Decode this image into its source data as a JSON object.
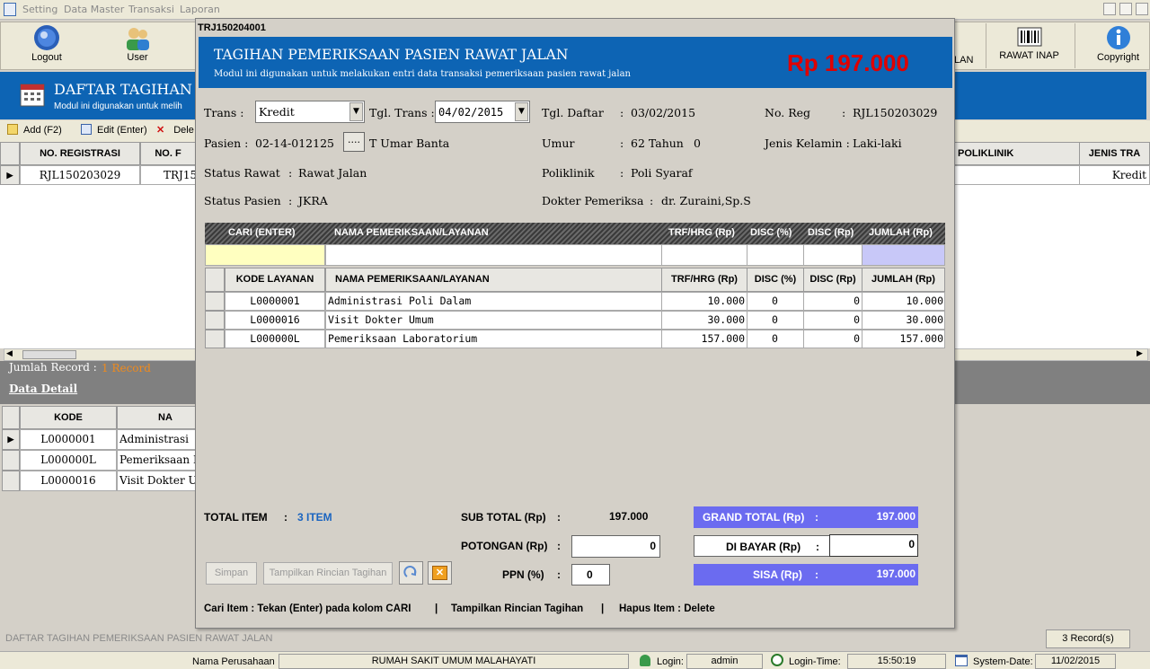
{
  "menubar": {
    "items": [
      "Setting",
      "Data Master",
      "Transaksi",
      "Laporan"
    ]
  },
  "toolbar": {
    "logout": "Logout",
    "user": "User",
    "lan_partial": "LAN",
    "rawat_inap": "RAWAT INAP",
    "copyright": "Copyright"
  },
  "main": {
    "title": "DAFTAR TAGIHAN",
    "subtitle": "Modul ini digunakan untuk melih",
    "actions": {
      "add": "Add (F2)",
      "edit": "Edit (Enter)",
      "delete": "Dele"
    },
    "columns": {
      "no_registrasi": "NO. REGISTRASI",
      "no_f": "NO. F",
      "poliklinik": "POLIKLINIK",
      "jenis_tra": "JENIS TRA"
    },
    "row": {
      "no_registrasi": "RJL150203029",
      "no_f": "TRJ15",
      "jenis": "Kredit"
    },
    "jumlah_record_label": "Jumlah Record :",
    "jumlah_record_value": "1 Record",
    "data_detail": "Data Detail",
    "detail_columns": {
      "kode": "KODE",
      "nama": "NA"
    },
    "detail_rows": [
      {
        "kode": "L0000001",
        "nama": "Administrasi"
      },
      {
        "kode": "L000000L",
        "nama": "Pemeriksaan L"
      },
      {
        "kode": "L0000016",
        "nama": "Visit Dokter U"
      }
    ],
    "footer_label": "DAFTAR TAGIHAN PEMERIKSAAN PASIEN RAWAT JALAN",
    "records": "3 Record(s)"
  },
  "dialog": {
    "window_title": "TRJ150204001",
    "header_title": "TAGIHAN PEMERIKSAAN PASIEN RAWAT JALAN",
    "header_subtitle": "Modul ini digunakan untuk melakukan entri data transaksi pemeriksaan pasien rawat jalan",
    "header_amount": "Rp 197.000",
    "form": {
      "trans_label": "Trans :",
      "trans_value": "Kredit",
      "tgl_trans_label": "Tgl. Trans :",
      "tgl_trans_value": "04/02/2015",
      "pasien_label": "Pasien :",
      "pasien_id": "02-14-012125",
      "browse": "....",
      "pasien_name": "T Umar Banta",
      "status_rawat_label": "Status Rawat",
      "status_rawat_value": "Rawat Jalan",
      "status_pasien_label": "Status Pasien",
      "status_pasien_value": "JKRA",
      "tgl_daftar_label": "Tgl. Daftar",
      "tgl_daftar_value": "03/02/2015",
      "umur_label": "Umur",
      "umur_value": "62 Tahun",
      "umur_extra": "0",
      "poliklinik_label": "Poliklinik",
      "poliklinik_value": "Poli Syaraf",
      "dokter_label": "Dokter Pemeriksa",
      "dokter_value": "dr. Zuraini,Sp.S",
      "no_reg_label": "No. Reg",
      "no_reg_value": "RJL150203029",
      "jk_label": "Jenis Kelamin :",
      "jk_value": "Laki-laki",
      "colon": ":"
    },
    "entry_header": {
      "cari": "CARI (ENTER)",
      "nama": "NAMA PEMERIKSAAN/LAYANAN",
      "trf": "TRF/HRG (Rp)",
      "disc_pct": "DISC (%)",
      "disc_rp": "DISC (Rp)",
      "jumlah": "JUMLAH (Rp)"
    },
    "items_header": {
      "kode": "KODE LAYANAN",
      "nama": "NAMA PEMERIKSAAN/LAYANAN",
      "trf": "TRF/HRG (Rp)",
      "disc_pct": "DISC (%)",
      "disc_rp": "DISC (Rp)",
      "jumlah": "JUMLAH (Rp)"
    },
    "items": [
      {
        "kode": "L0000001",
        "nama": "Administrasi Poli Dalam",
        "trf": "10.000",
        "disc_pct": "0",
        "disc_rp": "0",
        "jumlah": "10.000"
      },
      {
        "kode": "L0000016",
        "nama": "Visit Dokter Umum",
        "trf": "30.000",
        "disc_pct": "0",
        "disc_rp": "0",
        "jumlah": "30.000"
      },
      {
        "kode": "L000000L",
        "nama": "Pemeriksaan Laboratorium",
        "trf": "157.000",
        "disc_pct": "0",
        "disc_rp": "0",
        "jumlah": "157.000"
      }
    ],
    "totals": {
      "total_item_label": "TOTAL ITEM",
      "colon": ":",
      "total_item_value": "3 ITEM",
      "sub_total_label": "SUB TOTAL (Rp)",
      "sub_total_value": "197.000",
      "potongan_label": "POTONGAN (Rp)",
      "potongan_value": "0",
      "ppn_label": "PPN (%)",
      "ppn_value": "0",
      "grand_total_label": "GRAND TOTAL (Rp)",
      "grand_total_value": "197.000",
      "dibayar_label": "DI BAYAR (Rp)",
      "dibayar_value": "0",
      "sisa_label": "SISA (Rp)",
      "sisa_value": "197.000"
    },
    "buttons": {
      "simpan": "Simpan",
      "tampilkan": "Tampilkan Rincian Tagihan"
    },
    "help": {
      "cari": "Cari Item : Tekan (Enter) pada kolom CARI",
      "sep": "|",
      "tampilkan": "Tampilkan Rincian Tagihan",
      "hapus": "Hapus Item : Delete"
    }
  },
  "statusbar": {
    "nama_perusahaan": "Nama Perusahaan",
    "perusahaan": "RUMAH SAKIT UMUM MALAHAYATI",
    "login_label": "Login:",
    "login_value": "admin",
    "login_time_label": "Login-Time:",
    "login_time": "15:50:19",
    "system_date_label": "System-Date:",
    "system_date": "11/02/2015"
  },
  "colors": {
    "header_blue": "#0d64b4",
    "amount_red": "#e00000",
    "grand_total": "#6b6bf0",
    "entry_yellow": "#ffffc0",
    "entry_lilac": "#c8c8f8"
  }
}
